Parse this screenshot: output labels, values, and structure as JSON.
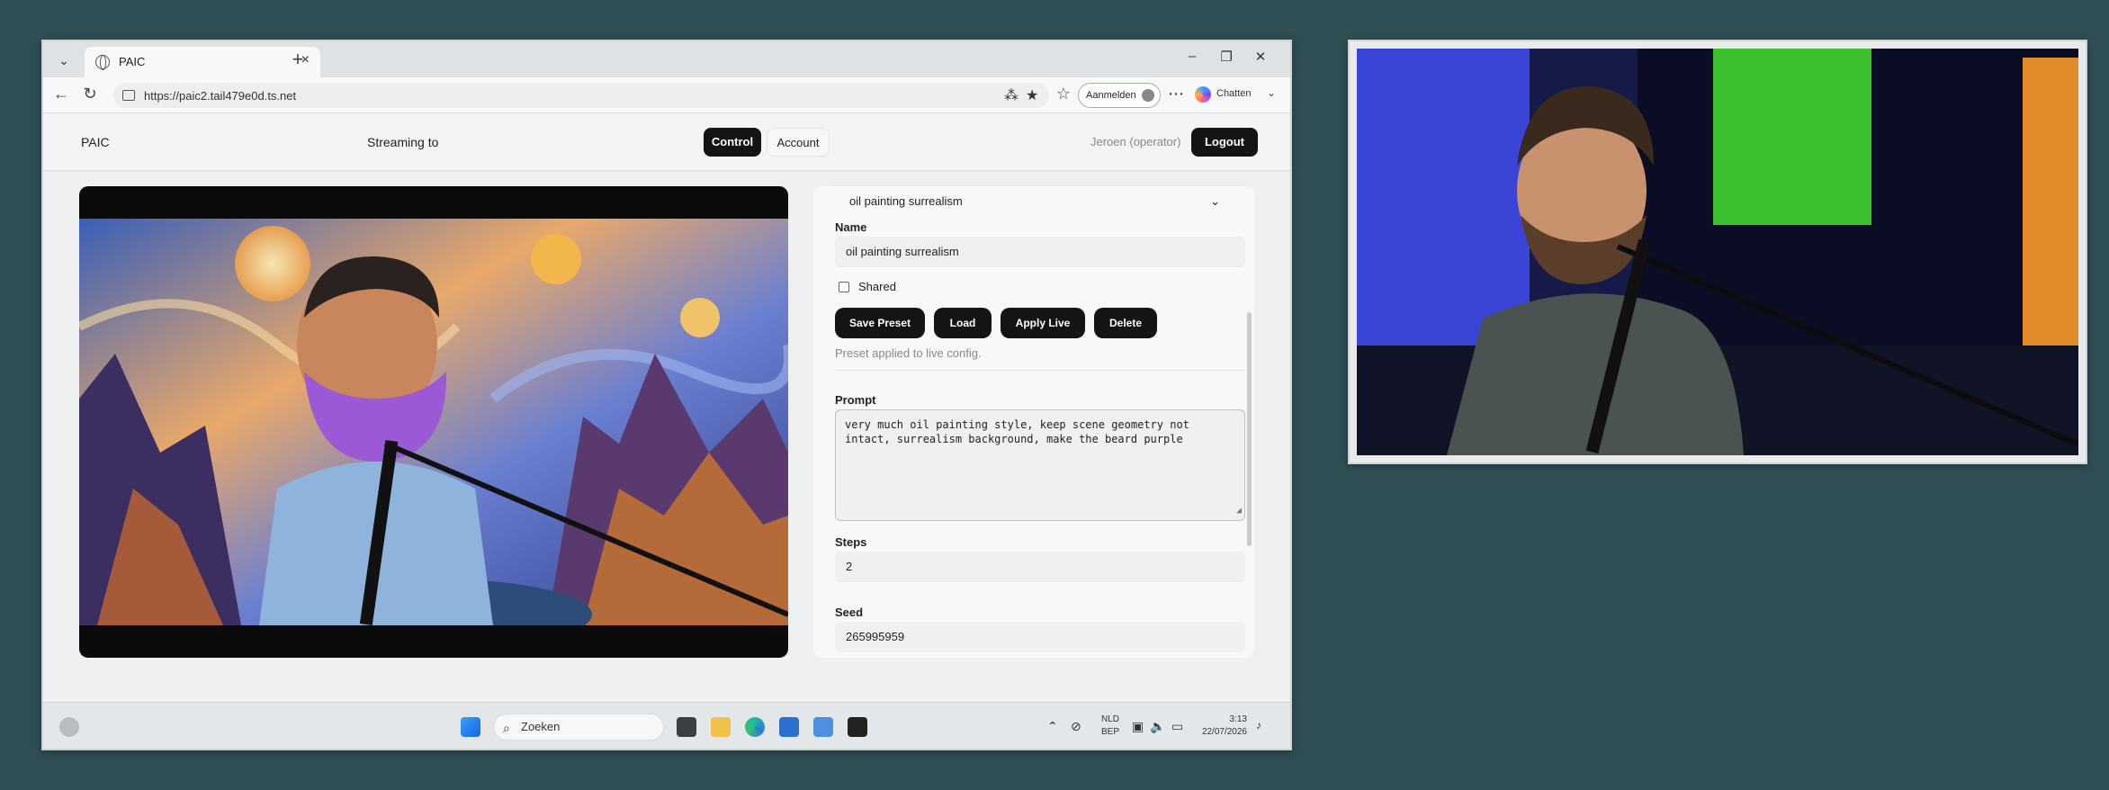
{
  "browser": {
    "tab_title": "PAIC",
    "url": "https://paic2.tail479e0d.ts.net",
    "signin_label": "Aanmelden",
    "copilot_label": "Chatten"
  },
  "app": {
    "brand": "PAIC",
    "streaming_label": "Streaming to",
    "nav": {
      "control": "Control",
      "account": "Account"
    },
    "user": "Jeroen (operator)",
    "logout": "Logout"
  },
  "panel": {
    "preset_selected": "oil painting surrealism",
    "name_label": "Name",
    "name_value": "oil painting surrealism",
    "shared_label": "Shared",
    "buttons": {
      "save": "Save Preset",
      "load": "Load",
      "apply": "Apply Live",
      "delete": "Delete"
    },
    "status": "Preset applied to live config.",
    "prompt_label": "Prompt",
    "prompt_value": "very much oil painting style, keep scene geometry not intact, surrealism background, make the beard purple",
    "steps_label": "Steps",
    "steps_value": "2",
    "seed_label": "Seed",
    "seed_value": "265995959"
  },
  "taskbar": {
    "search_placeholder": "Zoeken",
    "lang_line1": "NLD",
    "lang_line2": "BEP",
    "time": "3:13",
    "date": "22/07/2026"
  },
  "colors": {
    "background": "#2f4f54",
    "button_dark": "#141414",
    "beard_purple": "#9b59d6"
  }
}
